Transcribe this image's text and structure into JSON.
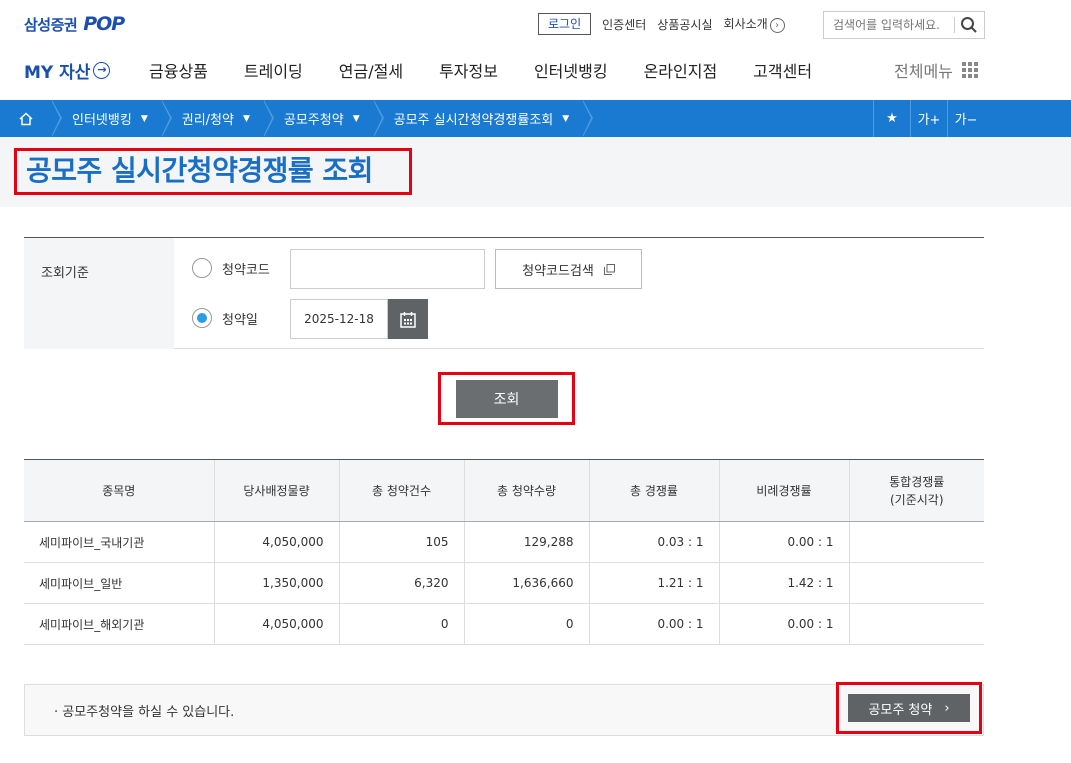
{
  "header": {
    "brand": "삼성증권",
    "brand_pop": "POP",
    "login": "로그인",
    "util_links": [
      "인증센터",
      "상품공시실",
      "회사소개"
    ],
    "search_placeholder": "검색어를 입력하세요."
  },
  "nav": {
    "my_asset": "MY 자산",
    "items": [
      "금융상품",
      "트레이딩",
      "연금/절세",
      "투자정보",
      "인터넷뱅킹",
      "온라인지점",
      "고객센터"
    ],
    "full_menu": "전체메뉴"
  },
  "breadcrumb": {
    "items": [
      "인터넷뱅킹",
      "권리/청약",
      "공모주청약",
      "공모주 실시간청약경쟁률조회"
    ],
    "font_up": "가+",
    "font_down": "가−"
  },
  "page_title": "공모주 실시간청약경쟁률 조회",
  "form": {
    "criteria_label": "조회기준",
    "radio_code": "청약코드",
    "radio_date": "청약일",
    "code_value": "",
    "code_search_btn": "청약코드검색",
    "date_value": "2025-12-18",
    "selected": "청약일"
  },
  "query_btn": "조회",
  "table": {
    "headers": [
      "종목명",
      "당사배정물량",
      "총 청약건수",
      "총 청약수량",
      "총 경쟁률",
      "비례경쟁률",
      "통합경쟁률",
      "(기준시각)"
    ],
    "rows": [
      [
        "세미파이브_국내기관",
        "4,050,000",
        "105",
        "129,288",
        "0.03 : 1",
        "0.00 : 1",
        ""
      ],
      [
        "세미파이브_일반",
        "1,350,000",
        "6,320",
        "1,636,660",
        "1.21 : 1",
        "1.42 : 1",
        ""
      ],
      [
        "세미파이브_해외기관",
        "4,050,000",
        "0",
        "0",
        "0.00 : 1",
        "0.00 : 1",
        ""
      ]
    ]
  },
  "notice": "· 공모주청약을 하실 수 있습니다.",
  "apply_btn": "공모주 청약",
  "colors": {
    "brand_blue": "#1a4fb0",
    "crumb_blue": "#1a79d1",
    "highlight_red": "#e60012",
    "button_gray": "#6b6e71"
  }
}
